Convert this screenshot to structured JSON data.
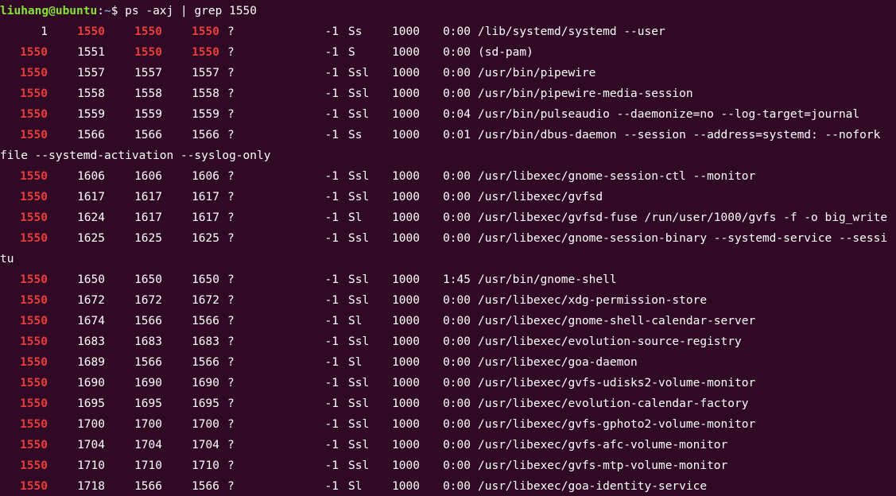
{
  "prompt": {
    "user_host": "liuhang@ubuntu",
    "colon": ":",
    "path": "~",
    "symbol": "$ ",
    "command": "ps -axj | grep 1550"
  },
  "highlight_color": "#ea3c3c",
  "lines": [
    {
      "type": "row",
      "ppid": "1",
      "pid": "1550",
      "pgid": "1550",
      "sid": "1550",
      "tty": "?",
      "tpgid": "-1",
      "stat": "Ss",
      "uid": "1000",
      "time": "0:00",
      "cmd": "/lib/systemd/systemd --user",
      "hl": [
        "pid",
        "pgid",
        "sid"
      ]
    },
    {
      "type": "row",
      "ppid": "1550",
      "pid": "1551",
      "pgid": "1550",
      "sid": "1550",
      "tty": "?",
      "tpgid": "-1",
      "stat": "S",
      "uid": "1000",
      "time": "0:00",
      "cmd": "(sd-pam)",
      "hl": [
        "ppid",
        "pgid",
        "sid"
      ]
    },
    {
      "type": "row",
      "ppid": "1550",
      "pid": "1557",
      "pgid": "1557",
      "sid": "1557",
      "tty": "?",
      "tpgid": "-1",
      "stat": "Ssl",
      "uid": "1000",
      "time": "0:00",
      "cmd": "/usr/bin/pipewire",
      "hl": [
        "ppid"
      ]
    },
    {
      "type": "row",
      "ppid": "1550",
      "pid": "1558",
      "pgid": "1558",
      "sid": "1558",
      "tty": "?",
      "tpgid": "-1",
      "stat": "Ssl",
      "uid": "1000",
      "time": "0:00",
      "cmd": "/usr/bin/pipewire-media-session",
      "hl": [
        "ppid"
      ]
    },
    {
      "type": "row",
      "ppid": "1550",
      "pid": "1559",
      "pgid": "1559",
      "sid": "1559",
      "tty": "?",
      "tpgid": "-1",
      "stat": "Ssl",
      "uid": "1000",
      "time": "0:04",
      "cmd": "/usr/bin/pulseaudio --daemonize=no --log-target=journal",
      "hl": [
        "ppid"
      ]
    },
    {
      "type": "row",
      "ppid": "1550",
      "pid": "1566",
      "pgid": "1566",
      "sid": "1566",
      "tty": "?",
      "tpgid": "-1",
      "stat": "Ss",
      "uid": "1000",
      "time": "0:01",
      "cmd": "/usr/bin/dbus-daemon --session --address=systemd: --nofork",
      "hl": [
        "ppid"
      ]
    },
    {
      "type": "wrap",
      "text": "file --systemd-activation --syslog-only"
    },
    {
      "type": "row",
      "ppid": "1550",
      "pid": "1606",
      "pgid": "1606",
      "sid": "1606",
      "tty": "?",
      "tpgid": "-1",
      "stat": "Ssl",
      "uid": "1000",
      "time": "0:00",
      "cmd": "/usr/libexec/gnome-session-ctl --monitor",
      "hl": [
        "ppid"
      ]
    },
    {
      "type": "row",
      "ppid": "1550",
      "pid": "1617",
      "pgid": "1617",
      "sid": "1617",
      "tty": "?",
      "tpgid": "-1",
      "stat": "Ssl",
      "uid": "1000",
      "time": "0:00",
      "cmd": "/usr/libexec/gvfsd",
      "hl": [
        "ppid"
      ]
    },
    {
      "type": "row",
      "ppid": "1550",
      "pid": "1624",
      "pgid": "1617",
      "sid": "1617",
      "tty": "?",
      "tpgid": "-1",
      "stat": "Sl",
      "uid": "1000",
      "time": "0:00",
      "cmd": "/usr/libexec/gvfsd-fuse /run/user/1000/gvfs -f -o big_write",
      "hl": [
        "ppid"
      ]
    },
    {
      "type": "row",
      "ppid": "1550",
      "pid": "1625",
      "pgid": "1625",
      "sid": "1625",
      "tty": "?",
      "tpgid": "-1",
      "stat": "Ssl",
      "uid": "1000",
      "time": "0:00",
      "cmd": "/usr/libexec/gnome-session-binary --systemd-service --sessi",
      "hl": [
        "ppid"
      ]
    },
    {
      "type": "wrap",
      "text": "tu"
    },
    {
      "type": "row",
      "ppid": "1550",
      "pid": "1650",
      "pgid": "1650",
      "sid": "1650",
      "tty": "?",
      "tpgid": "-1",
      "stat": "Ssl",
      "uid": "1000",
      "time": "1:45",
      "cmd": "/usr/bin/gnome-shell",
      "hl": [
        "ppid"
      ]
    },
    {
      "type": "row",
      "ppid": "1550",
      "pid": "1672",
      "pgid": "1672",
      "sid": "1672",
      "tty": "?",
      "tpgid": "-1",
      "stat": "Ssl",
      "uid": "1000",
      "time": "0:00",
      "cmd": "/usr/libexec/xdg-permission-store",
      "hl": [
        "ppid"
      ]
    },
    {
      "type": "row",
      "ppid": "1550",
      "pid": "1674",
      "pgid": "1566",
      "sid": "1566",
      "tty": "?",
      "tpgid": "-1",
      "stat": "Sl",
      "uid": "1000",
      "time": "0:00",
      "cmd": "/usr/libexec/gnome-shell-calendar-server",
      "hl": [
        "ppid"
      ]
    },
    {
      "type": "row",
      "ppid": "1550",
      "pid": "1683",
      "pgid": "1683",
      "sid": "1683",
      "tty": "?",
      "tpgid": "-1",
      "stat": "Ssl",
      "uid": "1000",
      "time": "0:00",
      "cmd": "/usr/libexec/evolution-source-registry",
      "hl": [
        "ppid"
      ]
    },
    {
      "type": "row",
      "ppid": "1550",
      "pid": "1689",
      "pgid": "1566",
      "sid": "1566",
      "tty": "?",
      "tpgid": "-1",
      "stat": "Sl",
      "uid": "1000",
      "time": "0:00",
      "cmd": "/usr/libexec/goa-daemon",
      "hl": [
        "ppid"
      ]
    },
    {
      "type": "row",
      "ppid": "1550",
      "pid": "1690",
      "pgid": "1690",
      "sid": "1690",
      "tty": "?",
      "tpgid": "-1",
      "stat": "Ssl",
      "uid": "1000",
      "time": "0:00",
      "cmd": "/usr/libexec/gvfs-udisks2-volume-monitor",
      "hl": [
        "ppid"
      ]
    },
    {
      "type": "row",
      "ppid": "1550",
      "pid": "1695",
      "pgid": "1695",
      "sid": "1695",
      "tty": "?",
      "tpgid": "-1",
      "stat": "Ssl",
      "uid": "1000",
      "time": "0:00",
      "cmd": "/usr/libexec/evolution-calendar-factory",
      "hl": [
        "ppid"
      ]
    },
    {
      "type": "row",
      "ppid": "1550",
      "pid": "1700",
      "pgid": "1700",
      "sid": "1700",
      "tty": "?",
      "tpgid": "-1",
      "stat": "Ssl",
      "uid": "1000",
      "time": "0:00",
      "cmd": "/usr/libexec/gvfs-gphoto2-volume-monitor",
      "hl": [
        "ppid"
      ]
    },
    {
      "type": "row",
      "ppid": "1550",
      "pid": "1704",
      "pgid": "1704",
      "sid": "1704",
      "tty": "?",
      "tpgid": "-1",
      "stat": "Ssl",
      "uid": "1000",
      "time": "0:00",
      "cmd": "/usr/libexec/gvfs-afc-volume-monitor",
      "hl": [
        "ppid"
      ]
    },
    {
      "type": "row",
      "ppid": "1550",
      "pid": "1710",
      "pgid": "1710",
      "sid": "1710",
      "tty": "?",
      "tpgid": "-1",
      "stat": "Ssl",
      "uid": "1000",
      "time": "0:00",
      "cmd": "/usr/libexec/gvfs-mtp-volume-monitor",
      "hl": [
        "ppid"
      ]
    },
    {
      "type": "row",
      "ppid": "1550",
      "pid": "1718",
      "pgid": "1566",
      "sid": "1566",
      "tty": "?",
      "tpgid": "-1",
      "stat": "Sl",
      "uid": "1000",
      "time": "0:00",
      "cmd": "/usr/libexec/goa-identity-service",
      "hl": [
        "ppid"
      ]
    }
  ]
}
